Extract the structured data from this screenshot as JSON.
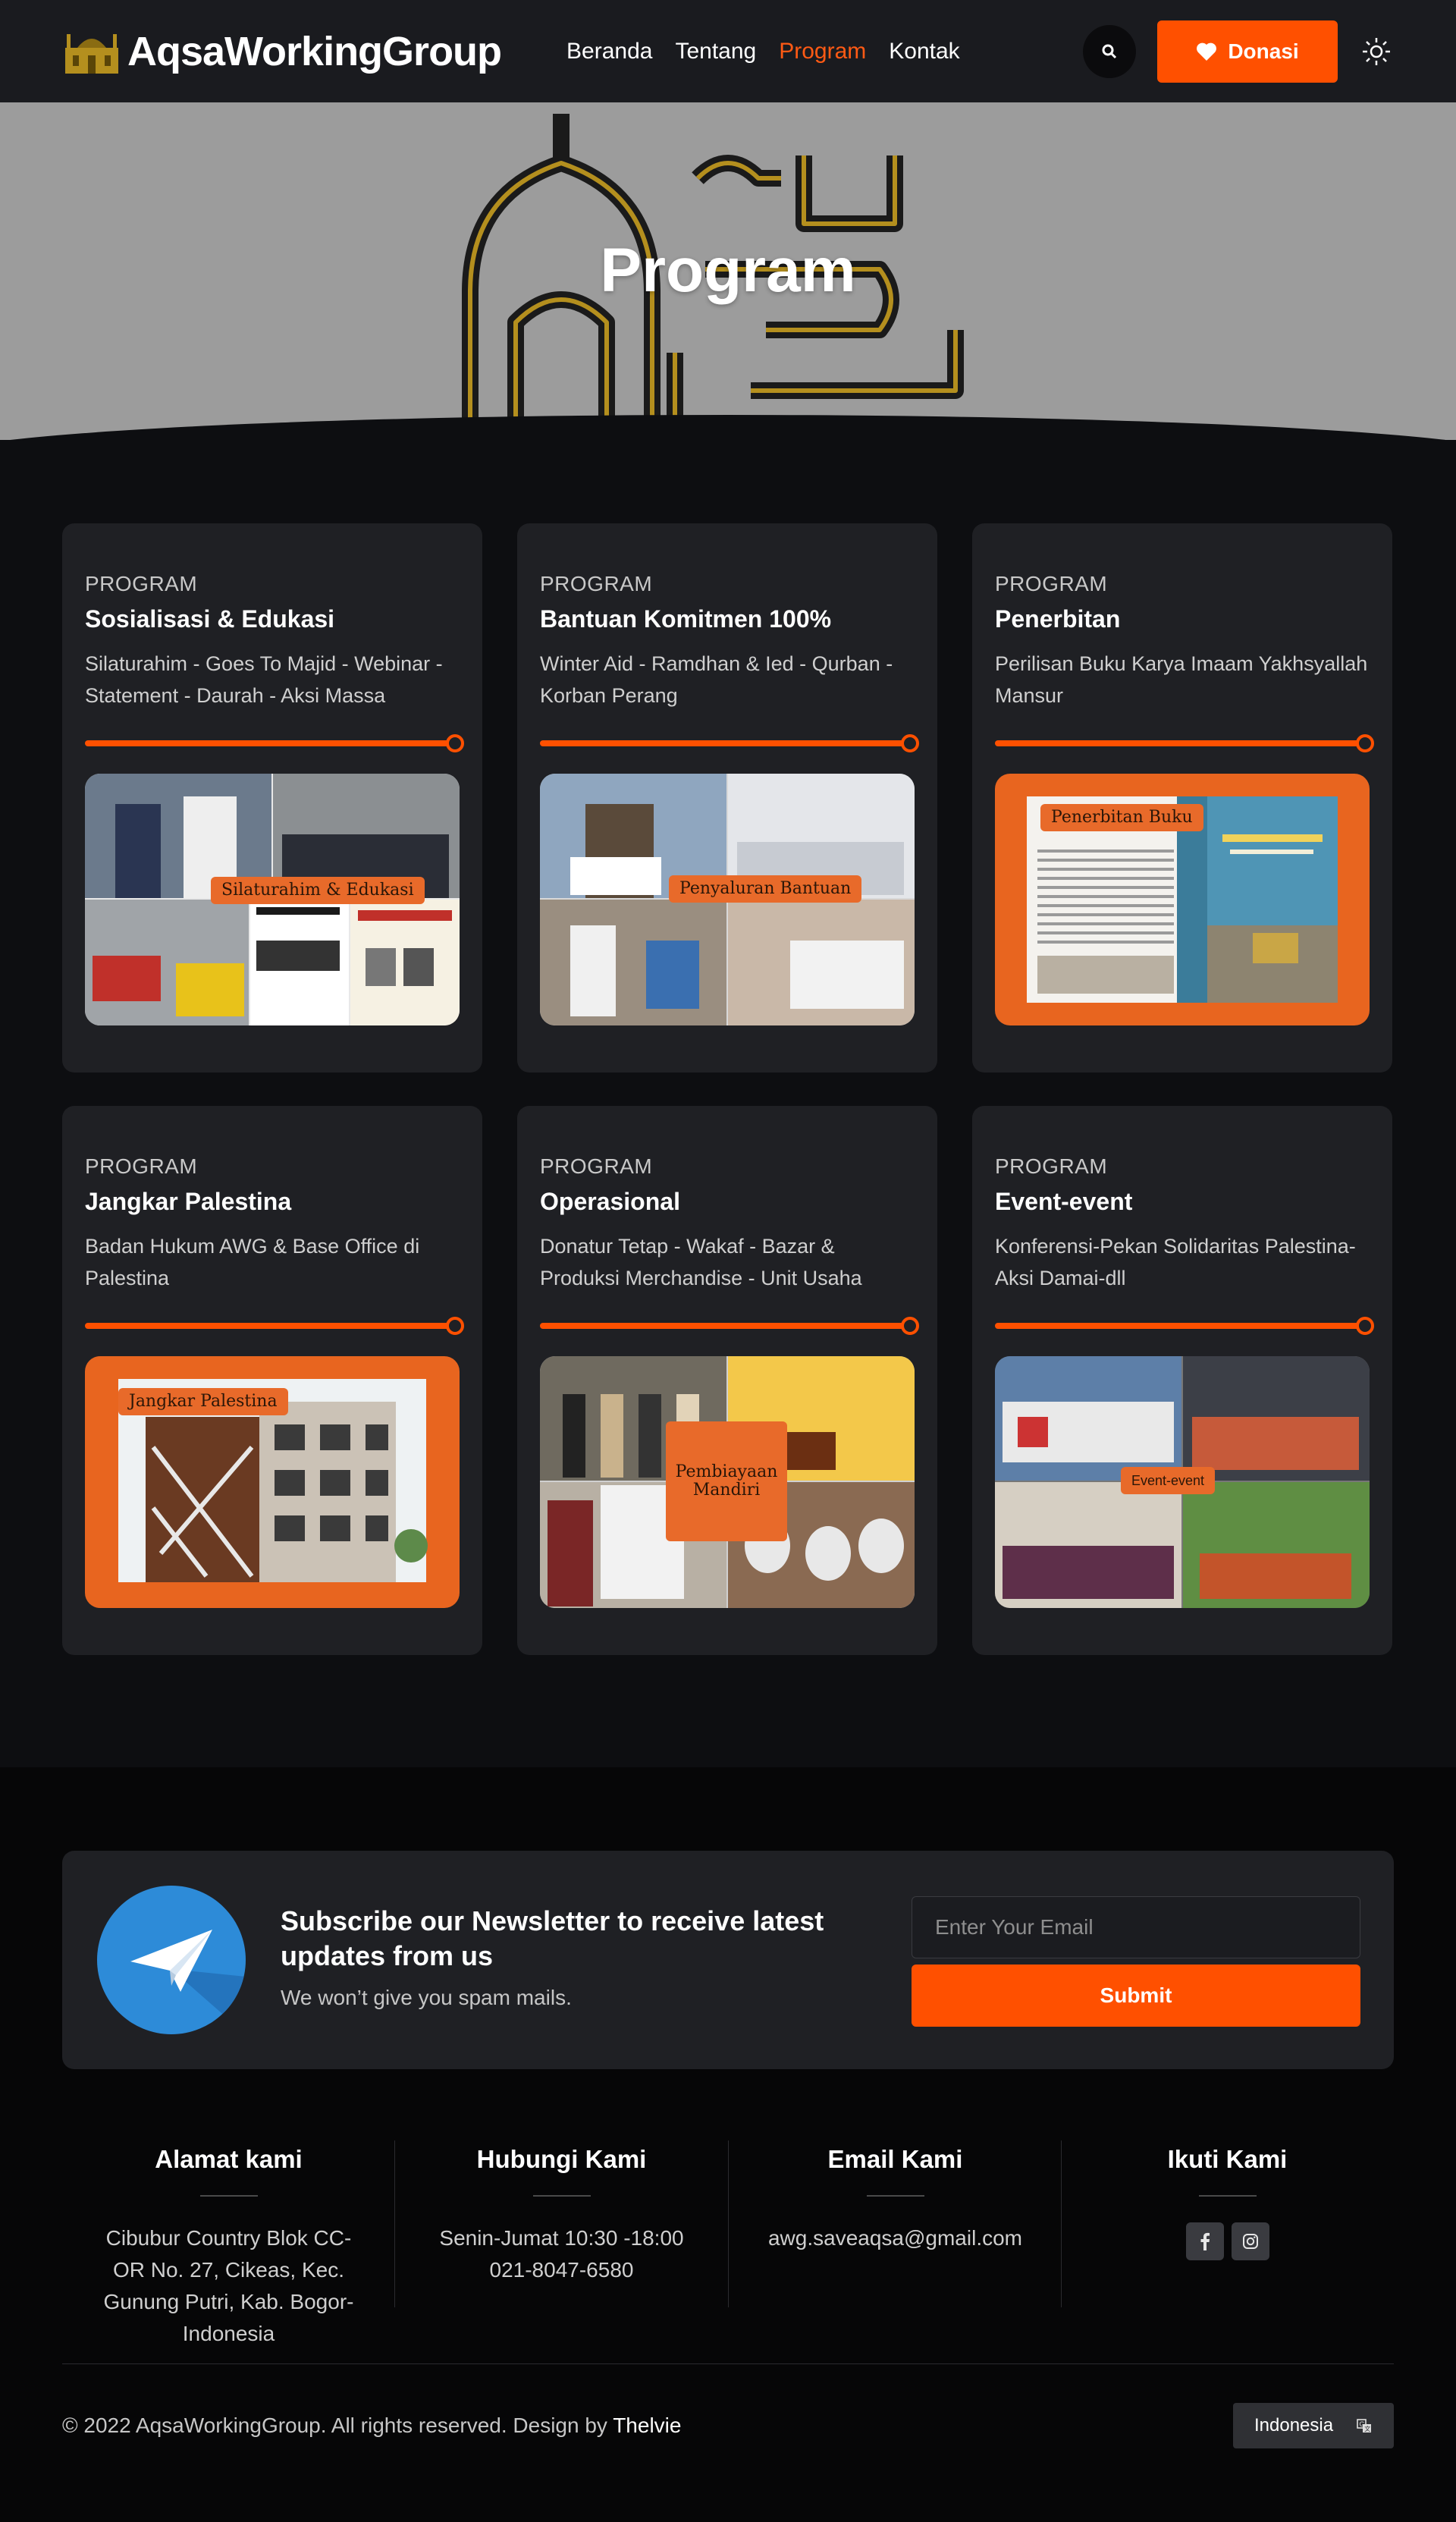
{
  "brand": {
    "name": "AqsaWorkingGroup",
    "accent": "#ff5000"
  },
  "nav": {
    "items": [
      {
        "label": "Beranda",
        "active": false
      },
      {
        "label": "Tentang",
        "active": false
      },
      {
        "label": "Program",
        "active": true
      },
      {
        "label": "Kontak",
        "active": false
      }
    ],
    "search_icon": "search-icon",
    "donate_label": "Donasi",
    "theme_icon": "sun-icon"
  },
  "hero": {
    "title": "Program"
  },
  "cards": [
    {
      "eyebrow": "PROGRAM",
      "title": "Sosialisasi & Edukasi",
      "desc": "Silaturahim - Goes To Majid - Webinar - Statement - Daurah - Aksi Massa",
      "tag": "Silaturahim & Edukasi",
      "progress": 1.0
    },
    {
      "eyebrow": "PROGRAM",
      "title": "Bantuan Komitmen 100%",
      "desc": "Winter Aid - Ramdhan & Ied - Qurban - Korban Perang",
      "tag": "Penyaluran Bantuan",
      "progress": 1.0
    },
    {
      "eyebrow": "PROGRAM",
      "title": "Penerbitan",
      "desc": "Perilisan Buku Karya Imaam Yakhsyallah Mansur",
      "tag": "Penerbitan Buku",
      "progress": 1.0
    },
    {
      "eyebrow": "PROGRAM",
      "title": "Jangkar Palestina",
      "desc": "Badan Hukum AWG & Base Office di Palestina",
      "tag": "Jangkar Palestina",
      "progress": 1.0
    },
    {
      "eyebrow": "PROGRAM",
      "title": "Operasional",
      "desc": "Donatur Tetap - Wakaf - Bazar & Produksi Merchandise - Unit Usaha",
      "tag": "Pembiayaan Mandiri",
      "progress": 1.0
    },
    {
      "eyebrow": "PROGRAM",
      "title": "Event-event",
      "desc": "Konferensi-Pekan Solidaritas Palestina-Aksi Damai-dll",
      "tag": "Event-event",
      "progress": 1.0
    }
  ],
  "newsletter": {
    "heading": "Subscribe our Newsletter to receive latest updates from us",
    "sub": "We won’t give you spam mails.",
    "placeholder": "Enter Your Email",
    "submit": "Submit"
  },
  "footer": {
    "address_title": "Alamat kami",
    "address": "Cibubur Country Blok CC-OR No. 27, Cikeas, Kec. Gunung Putri, Kab. Bogor-Indonesia",
    "contact_title": "Hubungi Kami",
    "hours": "Senin-Jumat 10:30 -18:00",
    "phone": "021-8047-6580",
    "email_title": "Email Kami",
    "email": "awg.saveaqsa@gmail.com",
    "follow_title": "Ikuti Kami",
    "social": [
      "facebook-icon",
      "instagram-icon"
    ],
    "copyright": "© 2022 AqsaWorkingGroup. All rights reserved. Design by",
    "designer": "Thelvie",
    "language": "Indonesia"
  }
}
